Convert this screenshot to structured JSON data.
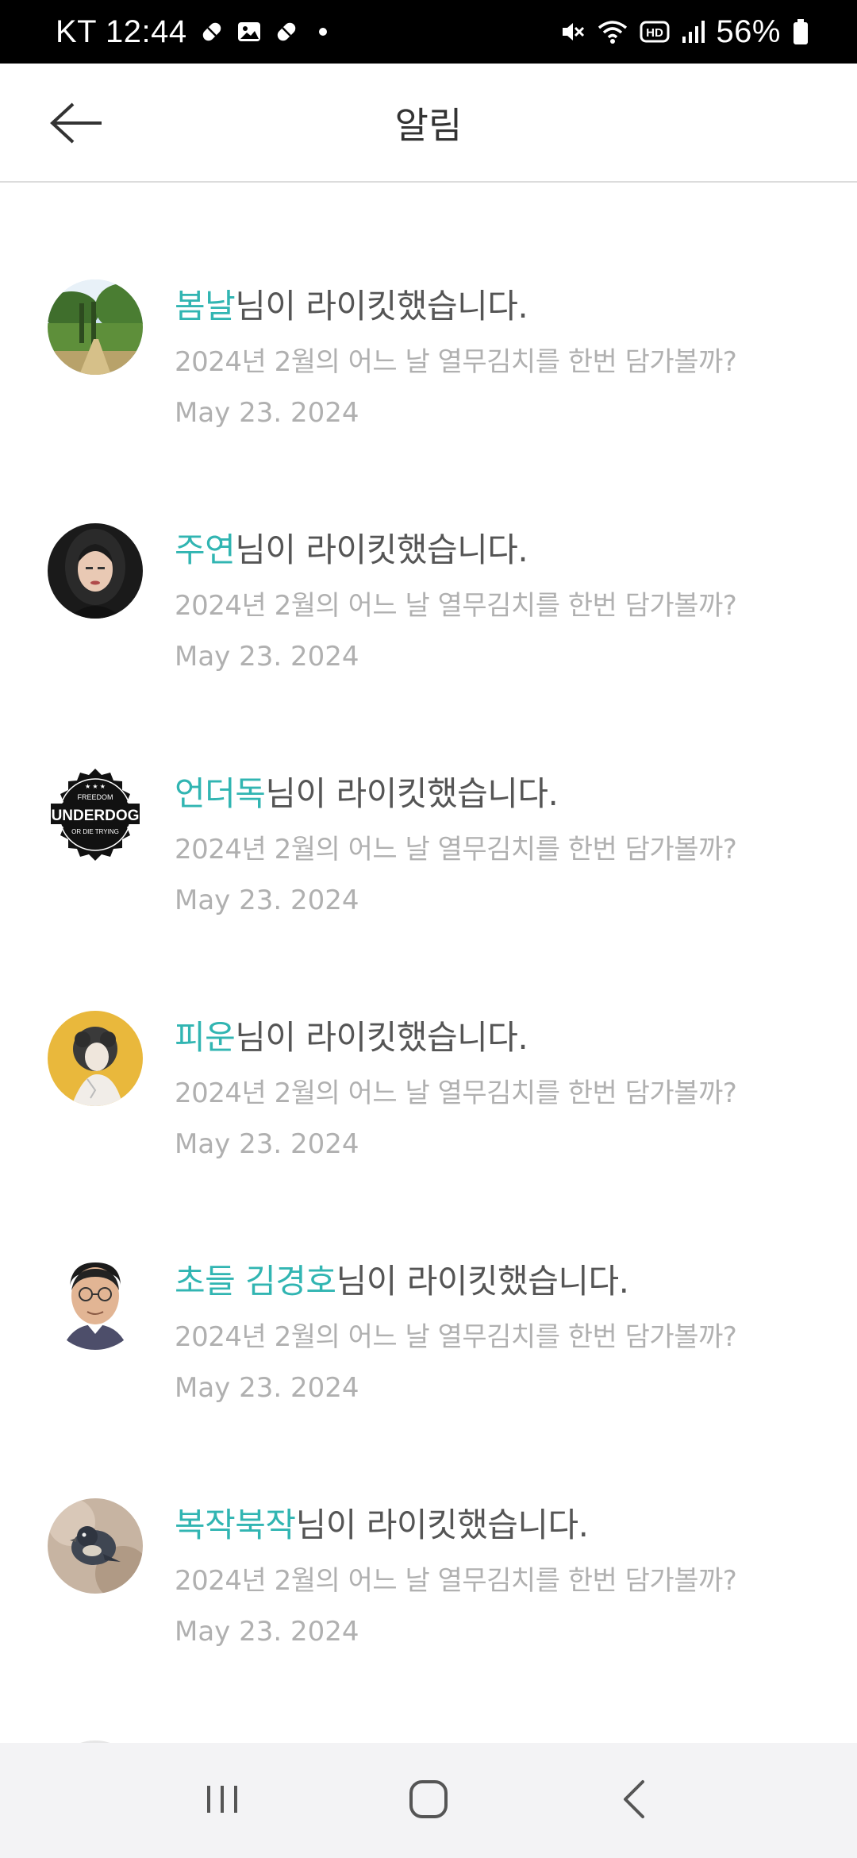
{
  "status_bar": {
    "carrier_time": "KT 12:44",
    "battery": "56%",
    "left_icons": [
      "pill-icon",
      "image-icon",
      "pill-icon",
      "dot-icon"
    ],
    "right_icons": [
      "mute-icon",
      "wifi-icon",
      "hd-icon",
      "signal-icon",
      "battery-icon"
    ]
  },
  "header": {
    "title": "알림",
    "back_icon": "arrow-left-icon"
  },
  "notifications": [
    {
      "user": "봄날",
      "action": "님이 라이킷했습니다.",
      "post": "2024년 2월의 어느 날 열무김치를 한번 담가볼까?",
      "date": "May 23. 2024",
      "avatar": "landscape"
    },
    {
      "user": "주연",
      "action": "님이 라이킷했습니다.",
      "post": "2024년 2월의 어느 날 열무김치를 한번 담가볼까?",
      "date": "May 23. 2024",
      "avatar": "portrait-woman"
    },
    {
      "user": "언더독",
      "action": "님이 라이킷했습니다.",
      "post": "2024년 2월의 어느 날 열무김치를 한번 담가볼까?",
      "date": "May 23. 2024",
      "avatar": "underdog-badge",
      "badge_text": {
        "top": "FREEDOM",
        "main": "UNDERDOG",
        "bottom": "OR DIE TRYING"
      }
    },
    {
      "user": "피운",
      "action": "님이 라이킷했습니다.",
      "post": "2024년 2월의 어느 날 열무김치를 한번 담가볼까?",
      "date": "May 23. 2024",
      "avatar": "illustration-person"
    },
    {
      "user": "초들 김경호",
      "action": "님이 라이킷했습니다.",
      "post": "2024년 2월의 어느 날 열무김치를 한번 담가볼까?",
      "date": "May 23. 2024",
      "avatar": "portrait-man"
    },
    {
      "user": "복작북작",
      "action": "님이 라이킷했습니다.",
      "post": "2024년 2월의 어느 날 열무김치를 한번 담가볼까?",
      "date": "May 23. 2024",
      "avatar": "bird"
    }
  ],
  "nav_bar": {
    "items": [
      "recent-apps-icon",
      "home-icon",
      "back-icon"
    ]
  },
  "colors": {
    "accent": "#31b5b2",
    "text": "#555555",
    "muted": "#b0b0b0",
    "status_bar": "#000000",
    "nav_bar": "#f3f3f5"
  }
}
